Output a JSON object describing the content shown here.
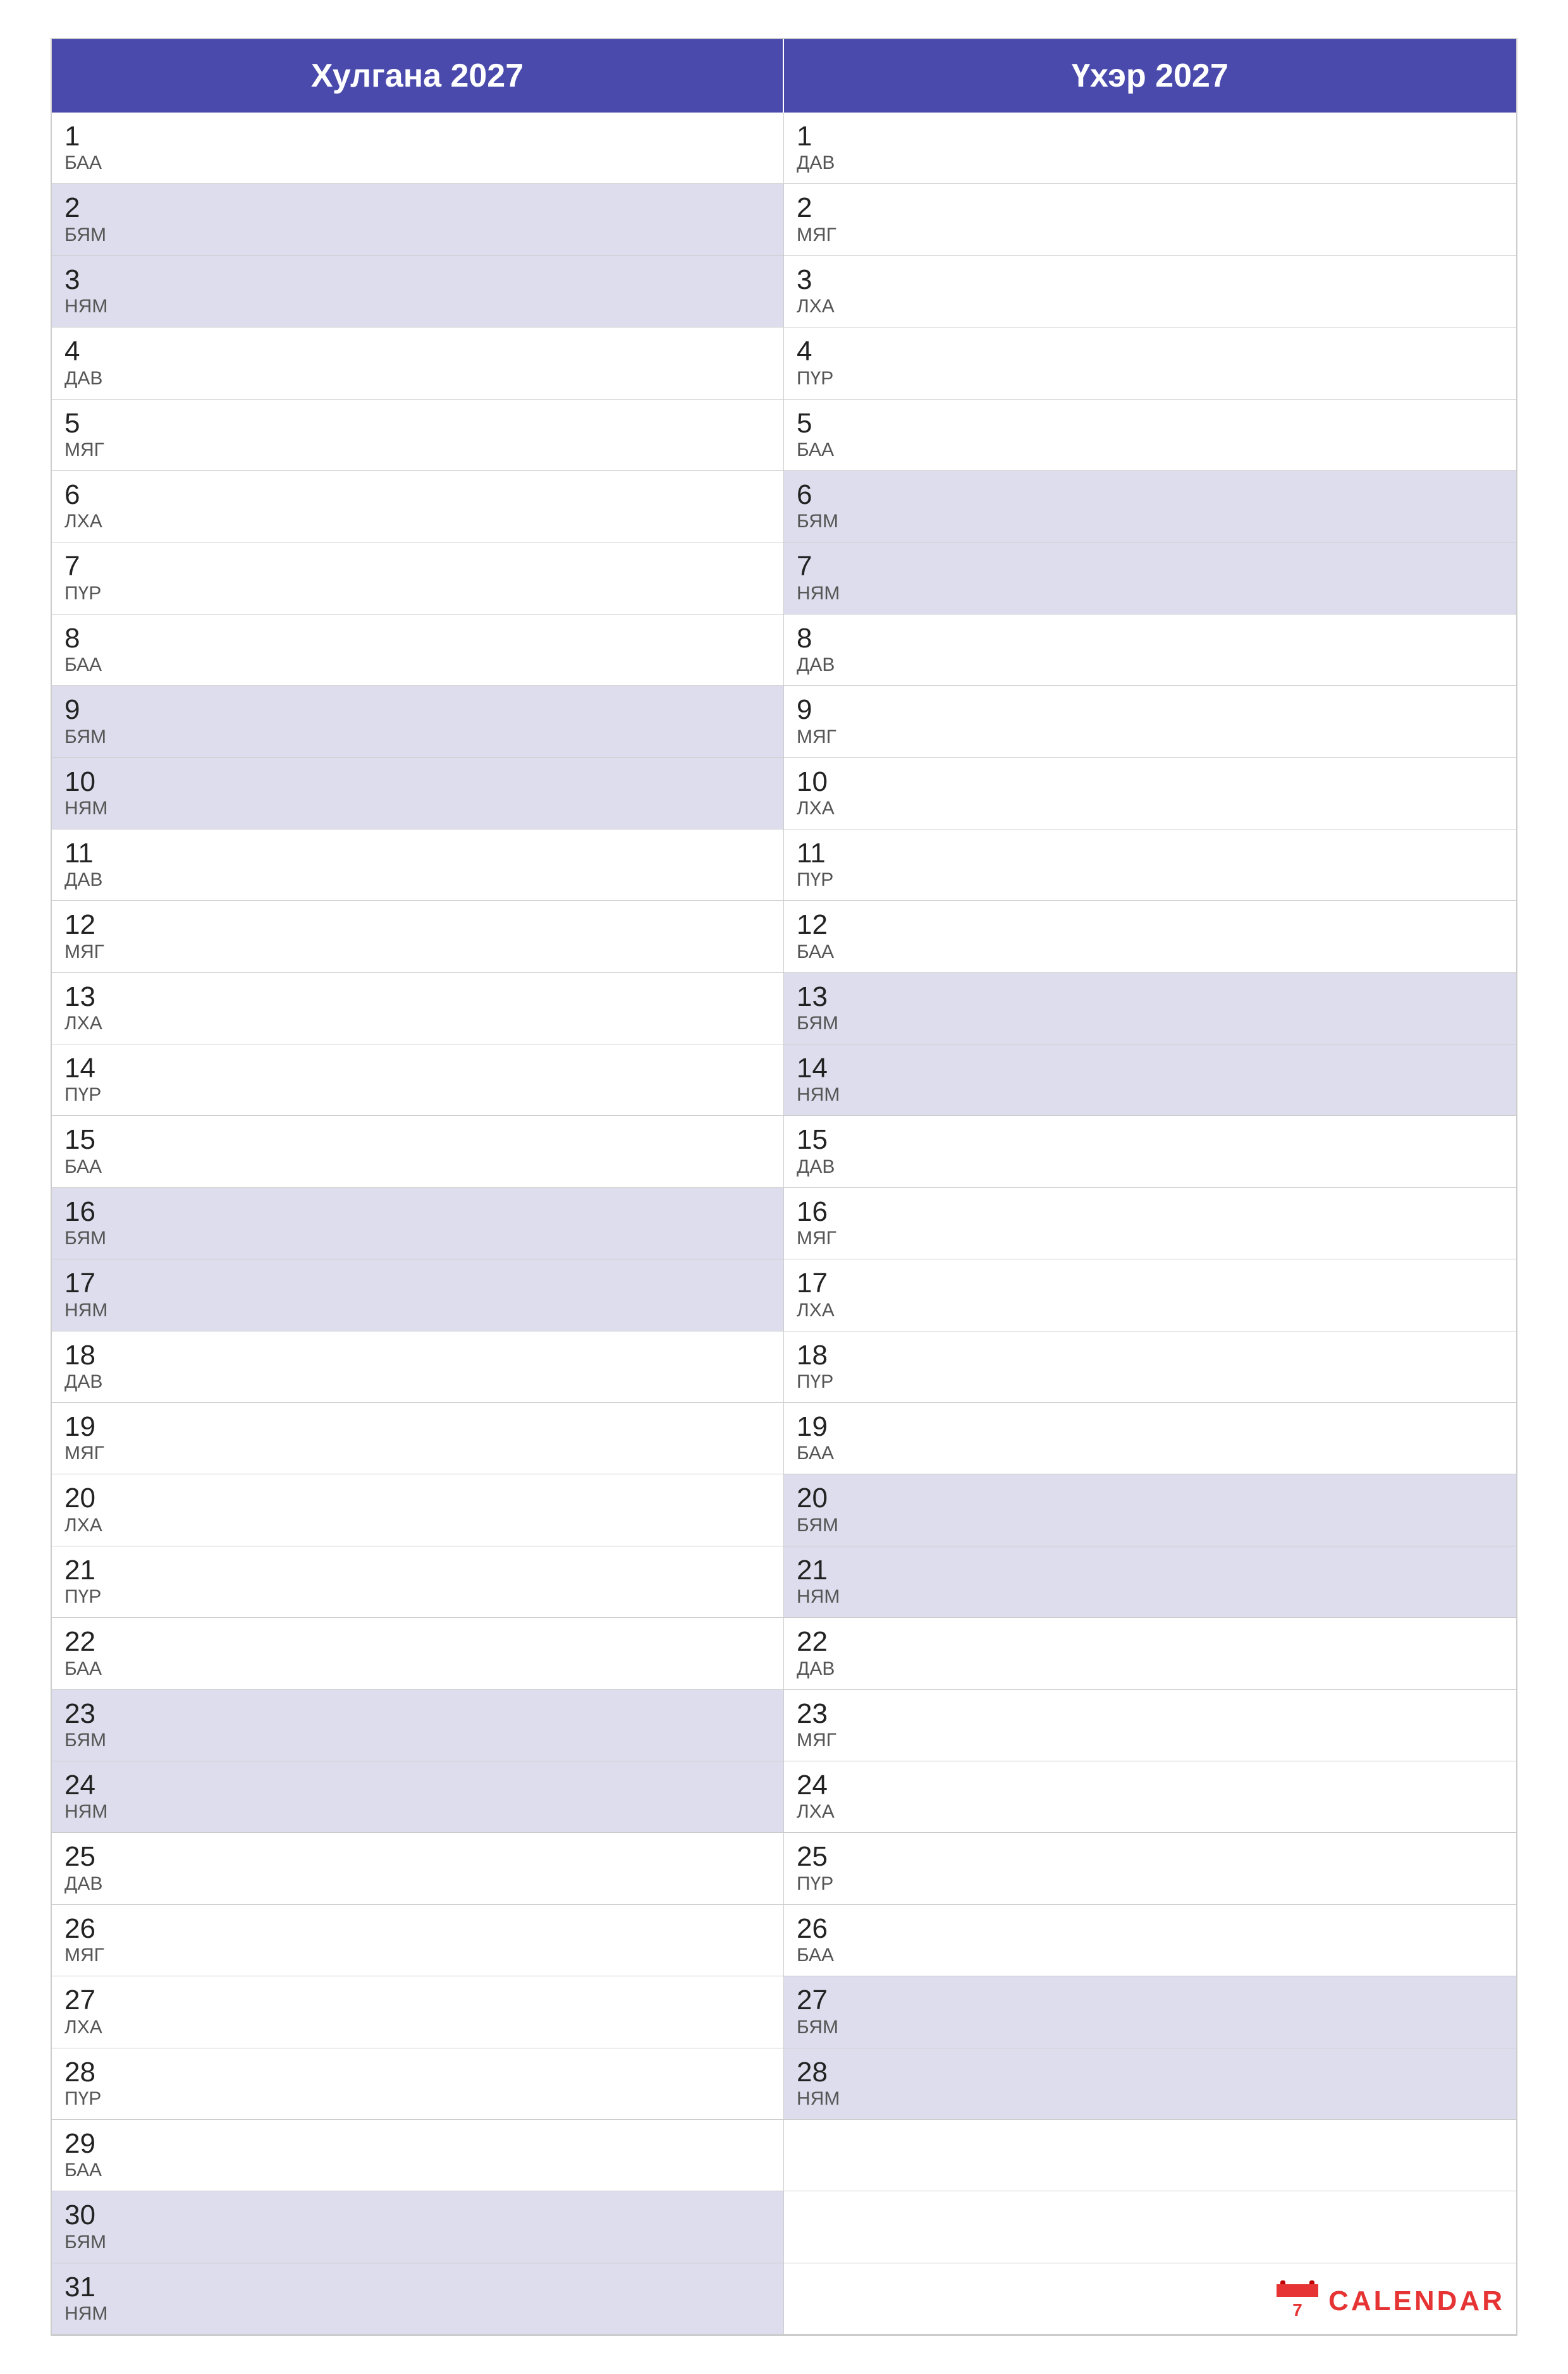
{
  "months": {
    "left": {
      "title": "Хулгана 2027",
      "days": [
        {
          "num": "1",
          "name": "БАА",
          "shaded": false
        },
        {
          "num": "2",
          "name": "БЯМ",
          "shaded": true
        },
        {
          "num": "3",
          "name": "НЯМ",
          "shaded": true
        },
        {
          "num": "4",
          "name": "ДАВ",
          "shaded": false
        },
        {
          "num": "5",
          "name": "МЯГ",
          "shaded": false
        },
        {
          "num": "6",
          "name": "ЛХА",
          "shaded": false
        },
        {
          "num": "7",
          "name": "ПҮР",
          "shaded": false
        },
        {
          "num": "8",
          "name": "БАА",
          "shaded": false
        },
        {
          "num": "9",
          "name": "БЯМ",
          "shaded": true
        },
        {
          "num": "10",
          "name": "НЯМ",
          "shaded": true
        },
        {
          "num": "11",
          "name": "ДАВ",
          "shaded": false
        },
        {
          "num": "12",
          "name": "МЯГ",
          "shaded": false
        },
        {
          "num": "13",
          "name": "ЛХА",
          "shaded": false
        },
        {
          "num": "14",
          "name": "ПҮР",
          "shaded": false
        },
        {
          "num": "15",
          "name": "БАА",
          "shaded": false
        },
        {
          "num": "16",
          "name": "БЯМ",
          "shaded": true
        },
        {
          "num": "17",
          "name": "НЯМ",
          "shaded": true
        },
        {
          "num": "18",
          "name": "ДАВ",
          "shaded": false
        },
        {
          "num": "19",
          "name": "МЯГ",
          "shaded": false
        },
        {
          "num": "20",
          "name": "ЛХА",
          "shaded": false
        },
        {
          "num": "21",
          "name": "ПҮР",
          "shaded": false
        },
        {
          "num": "22",
          "name": "БАА",
          "shaded": false
        },
        {
          "num": "23",
          "name": "БЯМ",
          "shaded": true
        },
        {
          "num": "24",
          "name": "НЯМ",
          "shaded": true
        },
        {
          "num": "25",
          "name": "ДАВ",
          "shaded": false
        },
        {
          "num": "26",
          "name": "МЯГ",
          "shaded": false
        },
        {
          "num": "27",
          "name": "ЛХА",
          "shaded": false
        },
        {
          "num": "28",
          "name": "ПҮР",
          "shaded": false
        },
        {
          "num": "29",
          "name": "БАА",
          "shaded": false
        },
        {
          "num": "30",
          "name": "БЯМ",
          "shaded": true
        },
        {
          "num": "31",
          "name": "НЯМ",
          "shaded": true
        }
      ]
    },
    "right": {
      "title": "Үхэр 2027",
      "days": [
        {
          "num": "1",
          "name": "ДАВ",
          "shaded": false
        },
        {
          "num": "2",
          "name": "МЯГ",
          "shaded": false
        },
        {
          "num": "3",
          "name": "ЛХА",
          "shaded": false
        },
        {
          "num": "4",
          "name": "ПҮР",
          "shaded": false
        },
        {
          "num": "5",
          "name": "БАА",
          "shaded": false
        },
        {
          "num": "6",
          "name": "БЯМ",
          "shaded": true
        },
        {
          "num": "7",
          "name": "НЯМ",
          "shaded": true
        },
        {
          "num": "8",
          "name": "ДАВ",
          "shaded": false
        },
        {
          "num": "9",
          "name": "МЯГ",
          "shaded": false
        },
        {
          "num": "10",
          "name": "ЛХА",
          "shaded": false
        },
        {
          "num": "11",
          "name": "ПҮР",
          "shaded": false
        },
        {
          "num": "12",
          "name": "БАА",
          "shaded": false
        },
        {
          "num": "13",
          "name": "БЯМ",
          "shaded": true
        },
        {
          "num": "14",
          "name": "НЯМ",
          "shaded": true
        },
        {
          "num": "15",
          "name": "ДАВ",
          "shaded": false
        },
        {
          "num": "16",
          "name": "МЯГ",
          "shaded": false
        },
        {
          "num": "17",
          "name": "ЛХА",
          "shaded": false
        },
        {
          "num": "18",
          "name": "ПҮР",
          "shaded": false
        },
        {
          "num": "19",
          "name": "БАА",
          "shaded": false
        },
        {
          "num": "20",
          "name": "БЯМ",
          "shaded": true
        },
        {
          "num": "21",
          "name": "НЯМ",
          "shaded": true
        },
        {
          "num": "22",
          "name": "ДАВ",
          "shaded": false
        },
        {
          "num": "23",
          "name": "МЯГ",
          "shaded": false
        },
        {
          "num": "24",
          "name": "ЛХА",
          "shaded": false
        },
        {
          "num": "25",
          "name": "ПҮР",
          "shaded": false
        },
        {
          "num": "26",
          "name": "БАА",
          "shaded": false
        },
        {
          "num": "27",
          "name": "БЯМ",
          "shaded": true
        },
        {
          "num": "28",
          "name": "НЯМ",
          "shaded": true
        }
      ]
    }
  },
  "logo": {
    "text": "CALENDAR"
  }
}
